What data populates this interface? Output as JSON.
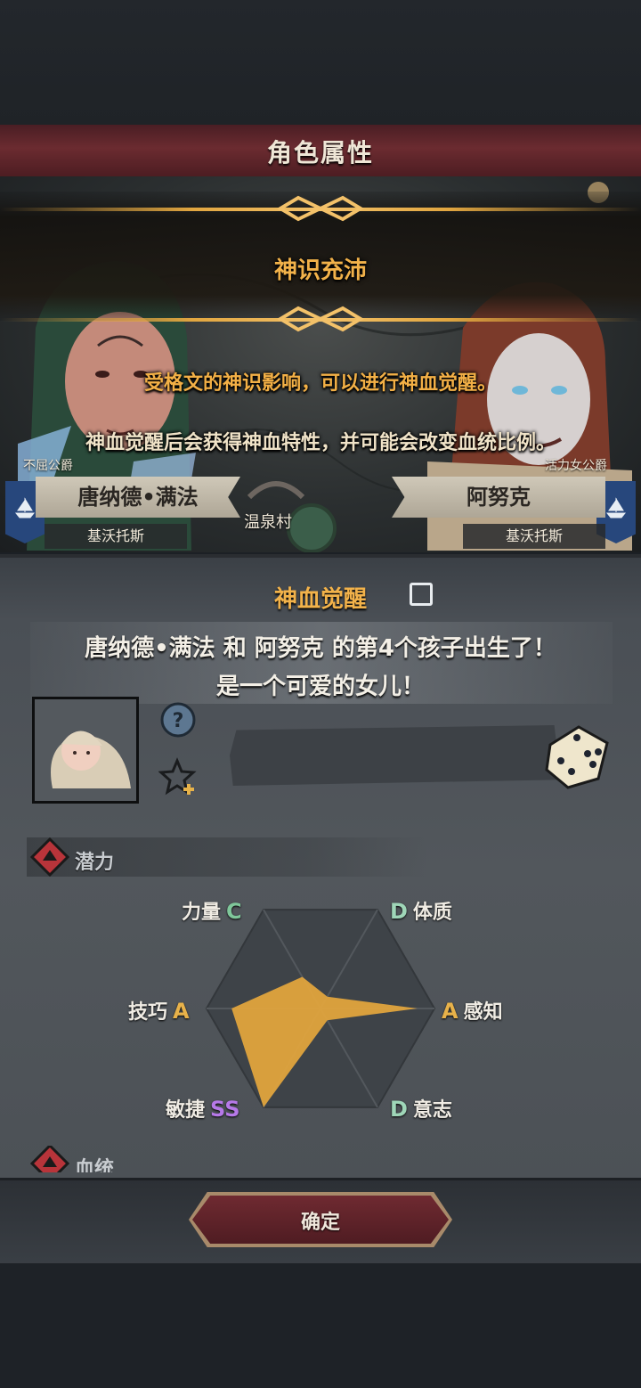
{
  "header": {
    "title": "角色属性"
  },
  "event": {
    "title": "神识充沛",
    "line1": "受格文的神识影响，可以进行神血觉醒。",
    "line2": "神血觉醒后会获得神血特性，并可能会改变血统比例。"
  },
  "left_character": {
    "title": "不屈公爵",
    "name": "唐纳德•满法",
    "region": "基沃托斯"
  },
  "right_character": {
    "title": "活力女公爵",
    "name": "阿努克",
    "region": "基沃托斯"
  },
  "map_location": "温泉村",
  "awakening": {
    "label": "神血觉醒",
    "checked": false
  },
  "birth": {
    "line1": "唐纳德•满法 和 阿努克 的第4个孩子出生了！",
    "line2": "是一个可爱的女儿！"
  },
  "potential": {
    "label": "潜力",
    "stats": [
      {
        "name": "力量",
        "grade": "C",
        "color": "#7fc79a",
        "value": 0.32
      },
      {
        "name": "体质",
        "grade": "D",
        "color": "#9fd6b8",
        "value": 0.12
      },
      {
        "name": "感知",
        "grade": "A",
        "color": "#e8b24a",
        "value": 0.85
      },
      {
        "name": "意志",
        "grade": "D",
        "color": "#9fd6b8",
        "value": 0.12
      },
      {
        "name": "敏捷",
        "grade": "SS",
        "color": "#b679e8",
        "value": 1.0
      },
      {
        "name": "技巧",
        "grade": "A",
        "color": "#e8b24a",
        "value": 0.78
      }
    ],
    "radar_fill": "#e0a43d"
  },
  "lineage": {
    "label": "血统"
  },
  "confirm_button": {
    "label": "确定"
  },
  "colors": {
    "accent_gold": "#f2b24a",
    "banner_red": "#6b2b30",
    "flag_blue": "#27477c"
  }
}
